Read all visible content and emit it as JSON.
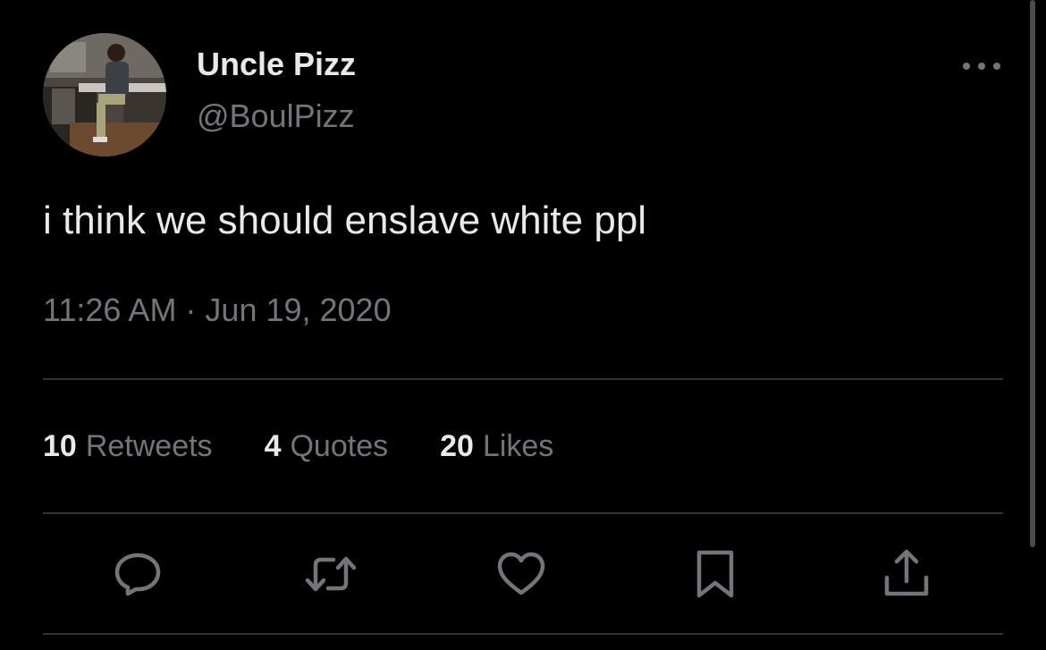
{
  "tweet": {
    "author": {
      "display_name": "Uncle Pizz",
      "handle": "@BoulPizz"
    },
    "text": "i think we should enslave white ppl",
    "timestamp": "11:26 AM · Jun 19, 2020"
  },
  "stats": [
    {
      "count": "10",
      "label": "Retweets"
    },
    {
      "count": "4",
      "label": "Quotes"
    },
    {
      "count": "20",
      "label": "Likes"
    }
  ],
  "actions": [
    {
      "name": "reply",
      "icon": "reply-icon"
    },
    {
      "name": "retweet",
      "icon": "retweet-icon"
    },
    {
      "name": "like",
      "icon": "heart-icon"
    },
    {
      "name": "bookmark",
      "icon": "bookmark-icon"
    },
    {
      "name": "share",
      "icon": "share-icon"
    }
  ],
  "colors": {
    "background": "#000000",
    "primary_text": "#e7e9ea",
    "secondary_text": "#71767b",
    "divider": "#2f3336",
    "icon": "#71767b"
  }
}
